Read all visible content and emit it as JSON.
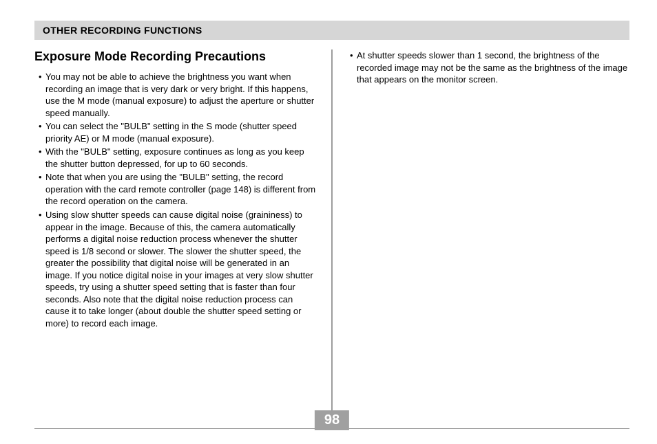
{
  "header": "OTHER RECORDING FUNCTIONS",
  "heading": "Exposure Mode Recording Precautions",
  "left_bullets": [
    "You may not be able to achieve the brightness you want when recording an image that is very dark or very bright. If this happens, use the M mode (manual exposure) to adjust the aperture or shutter speed manually.",
    "You can select the \"BULB\" setting in the S mode (shutter speed priority AE) or M mode (manual exposure).",
    "With the \"BULB\" setting, exposure continues as long as you keep the shutter button depressed, for up to 60 seconds.",
    "Note that when you are using the \"BULB\" setting, the record operation with the card remote controller (page 148) is different from the record operation on the camera.",
    "Using slow shutter speeds can cause digital noise (graininess) to appear in the image. Because of this, the camera automatically performs a digital noise reduction process whenever the shutter speed is 1/8 second or slower. The slower the shutter speed, the greater the possibility that digital noise will be generated in an image. If you notice digital noise in your images at very slow shutter speeds, try using a shutter speed setting that is faster than four seconds. Also note that the digital noise reduction process can cause it to take longer (about double the shutter speed setting or more) to record each image."
  ],
  "right_bullets": [
    "At shutter speeds slower than 1 second, the brightness of the recorded image may not be the same as the brightness of the image that appears on the monitor screen."
  ],
  "page_number": "98"
}
